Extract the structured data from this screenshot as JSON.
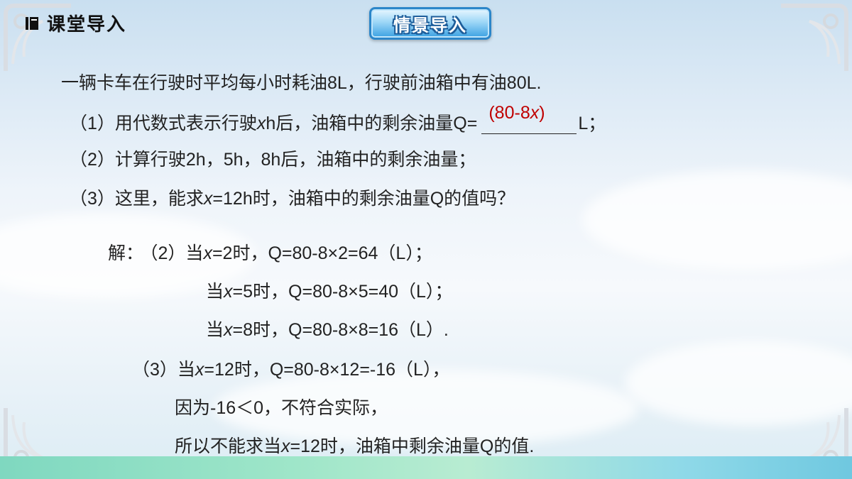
{
  "header": {
    "title": "课堂导入"
  },
  "badge": {
    "label": "情景导入"
  },
  "problem": {
    "intro": "一辆卡车在行驶时平均每小时耗油8L，行驶前油箱中有油80L.",
    "q1_prefix": "（1）用代数式表示行驶",
    "q1_var": "x",
    "q1_mid": "h后，油箱中的剩余油量Q=",
    "q1_answer_a": "(80-8",
    "q1_answer_var": "x",
    "q1_answer_b": ")",
    "q1_suffix": "L；",
    "q2": "（2）计算行驶2h，5h，8h后，油箱中的剩余油量；",
    "q3_prefix": "（3）这里，能求",
    "q3_var": "x",
    "q3_suffix": "=12h时，油箱中的剩余油量Q的值吗？"
  },
  "solution": {
    "label": "解：",
    "part2": "（2）",
    "when": "当",
    "var": "x",
    "l1": "=2时，Q=80-8×2=64（L）；",
    "l2": "=5时，Q=80-8×5=40（L）；",
    "l3": "=8时，Q=80-8×8=16（L）.",
    "part3": "（3）",
    "l4": "=12时，Q=80-8×12=-16（L），",
    "l5": "因为-16＜0，不符合实际，",
    "l6_prefix": "所以不能求当",
    "l6_suffix": "=12时，油箱中剩余油量Q的值."
  },
  "colors": {
    "answer": "#c00000",
    "badge_border": "#2c86c9",
    "bottom_bar": "#9fe6c9"
  },
  "icons": [
    "book-icon",
    "corner-ornament-icon"
  ]
}
